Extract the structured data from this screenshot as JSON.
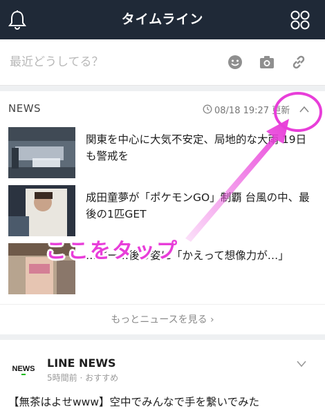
{
  "header": {
    "title": "タイムライン",
    "bell_icon": "bell-icon",
    "menu_icon": "grid-menu-icon",
    "background": "#1f2937"
  },
  "post_bar": {
    "placeholder": "最近どうしてる？",
    "icons": [
      "emoji-icon",
      "camera-icon",
      "link-icon"
    ]
  },
  "news": {
    "label": "NEWS",
    "updated": "08/18 19:27 更新",
    "items": [
      {
        "text": "関東を中心に大気不安定、局地的な大雨 19日も警戒を"
      },
      {
        "text": "成田童夢が「ポケモンGO」制覇 台風の中、最後の1匹GET"
      },
      {
        "text": "…ピー…後ろ姿に「かえって想像力が…」"
      }
    ],
    "more": "もっとニュースを見る ›"
  },
  "post": {
    "logo_text": "NEWS",
    "account": "LINE NEWS",
    "meta": "5時間前 · おすすめ",
    "body": "【無茶はよせwww】空中でみんなで手を繋いでみた"
  },
  "annotation": {
    "text": "ここをタップ",
    "color": "#e83ed9"
  }
}
